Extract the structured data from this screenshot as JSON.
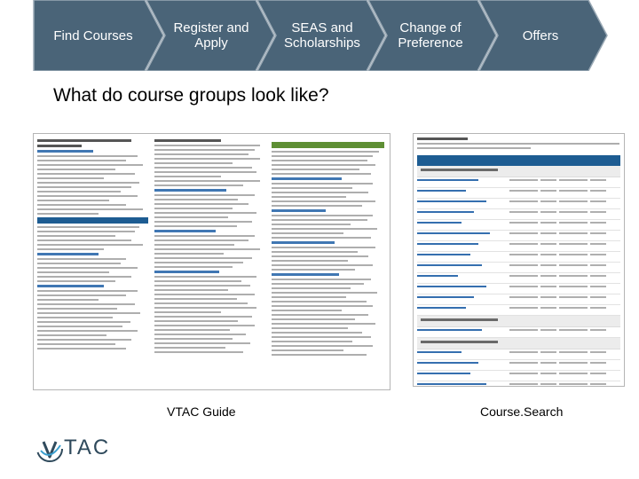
{
  "nav": {
    "items": [
      {
        "label": "Find Courses"
      },
      {
        "label": "Register and Apply"
      },
      {
        "label": "SEAS and Scholarships"
      },
      {
        "label": "Change of Preference"
      },
      {
        "label": "Offers"
      }
    ],
    "color": "#4a6478",
    "border_color": "#9aa9b5"
  },
  "main": {
    "title": "What do course groups look like?"
  },
  "images": {
    "left_caption": "VTAC Guide",
    "right_caption": "Course.Search"
  },
  "logo": {
    "text": "TAC",
    "icon": "v-swoosh-logo-icon",
    "color": "#2f4a5c",
    "accent": "#3a9fcf"
  }
}
